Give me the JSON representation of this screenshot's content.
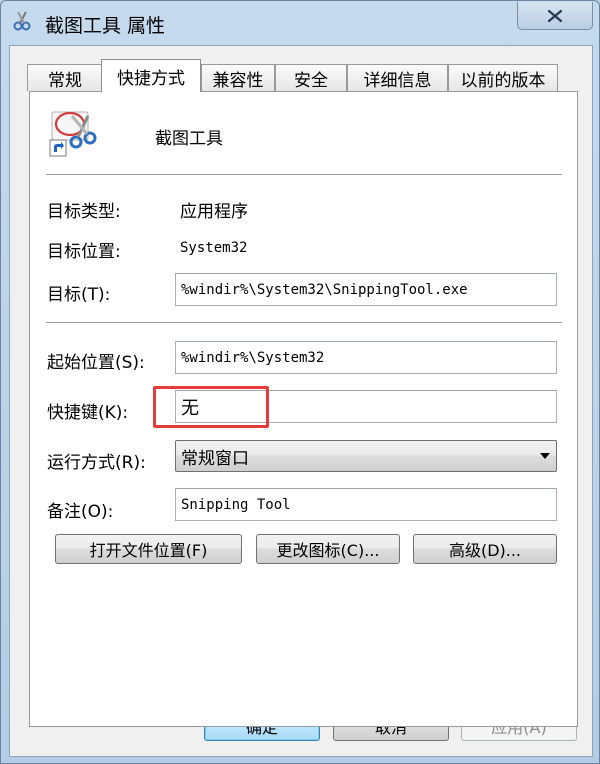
{
  "window": {
    "title": "截图工具 属性",
    "close_icon": "close-icon"
  },
  "tabs": [
    {
      "label": "常规",
      "active": false
    },
    {
      "label": "快捷方式",
      "active": true
    },
    {
      "label": "兼容性",
      "active": false
    },
    {
      "label": "安全",
      "active": false
    },
    {
      "label": "详细信息",
      "active": false
    },
    {
      "label": "以前的版本",
      "active": false
    }
  ],
  "shortcut": {
    "name": "截图工具",
    "icon": "scissors-shortcut-icon",
    "target_type_label": "目标类型:",
    "target_type_value": "应用程序",
    "target_location_label": "目标位置:",
    "target_location_value": "System32",
    "target_label": "目标(T):",
    "target_value": "%windir%\\System32\\SnippingTool.exe",
    "start_in_label": "起始位置(S):",
    "start_in_value": "%windir%\\System32",
    "hotkey_label": "快捷键(K):",
    "hotkey_value": "无",
    "run_label": "运行方式(R):",
    "run_value": "常规窗口",
    "comment_label": "备注(O):",
    "comment_value": "Snipping Tool",
    "open_location_button": "打开文件位置(F)",
    "change_icon_button": "更改图标(C)...",
    "advanced_button": "高级(D)..."
  },
  "footer": {
    "ok_label": "确定",
    "cancel_label": "取消",
    "apply_label": "应用(A)"
  },
  "colors": {
    "highlight": "#e43c3c",
    "default_button": "#a7d9f5"
  }
}
